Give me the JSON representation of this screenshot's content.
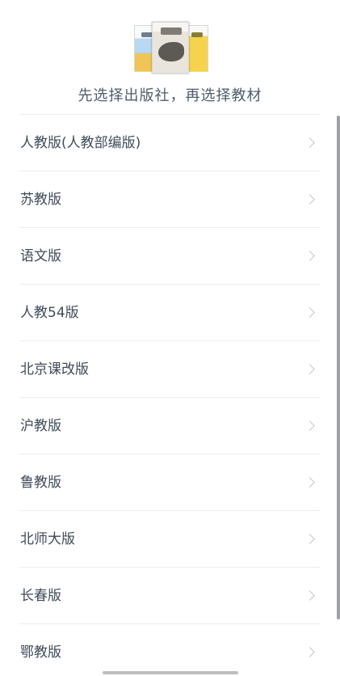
{
  "header": {
    "subtitle": "先选择出版社，再选择教材"
  },
  "publishers": [
    {
      "label": "人教版(人教部编版)"
    },
    {
      "label": "苏教版"
    },
    {
      "label": "语文版"
    },
    {
      "label": "人教54版"
    },
    {
      "label": "北京课改版"
    },
    {
      "label": "沪教版"
    },
    {
      "label": "鲁教版"
    },
    {
      "label": "北师大版"
    },
    {
      "label": "长春版"
    },
    {
      "label": "鄂教版"
    }
  ],
  "icons": {
    "item_arrow": "chevron-right-icon",
    "header_image": "textbook-covers-icon"
  },
  "colors": {
    "text": "#3f4b58",
    "subtitle": "#4f5d6b",
    "divider": "#ededed",
    "chevron": "#c7c7c7"
  }
}
